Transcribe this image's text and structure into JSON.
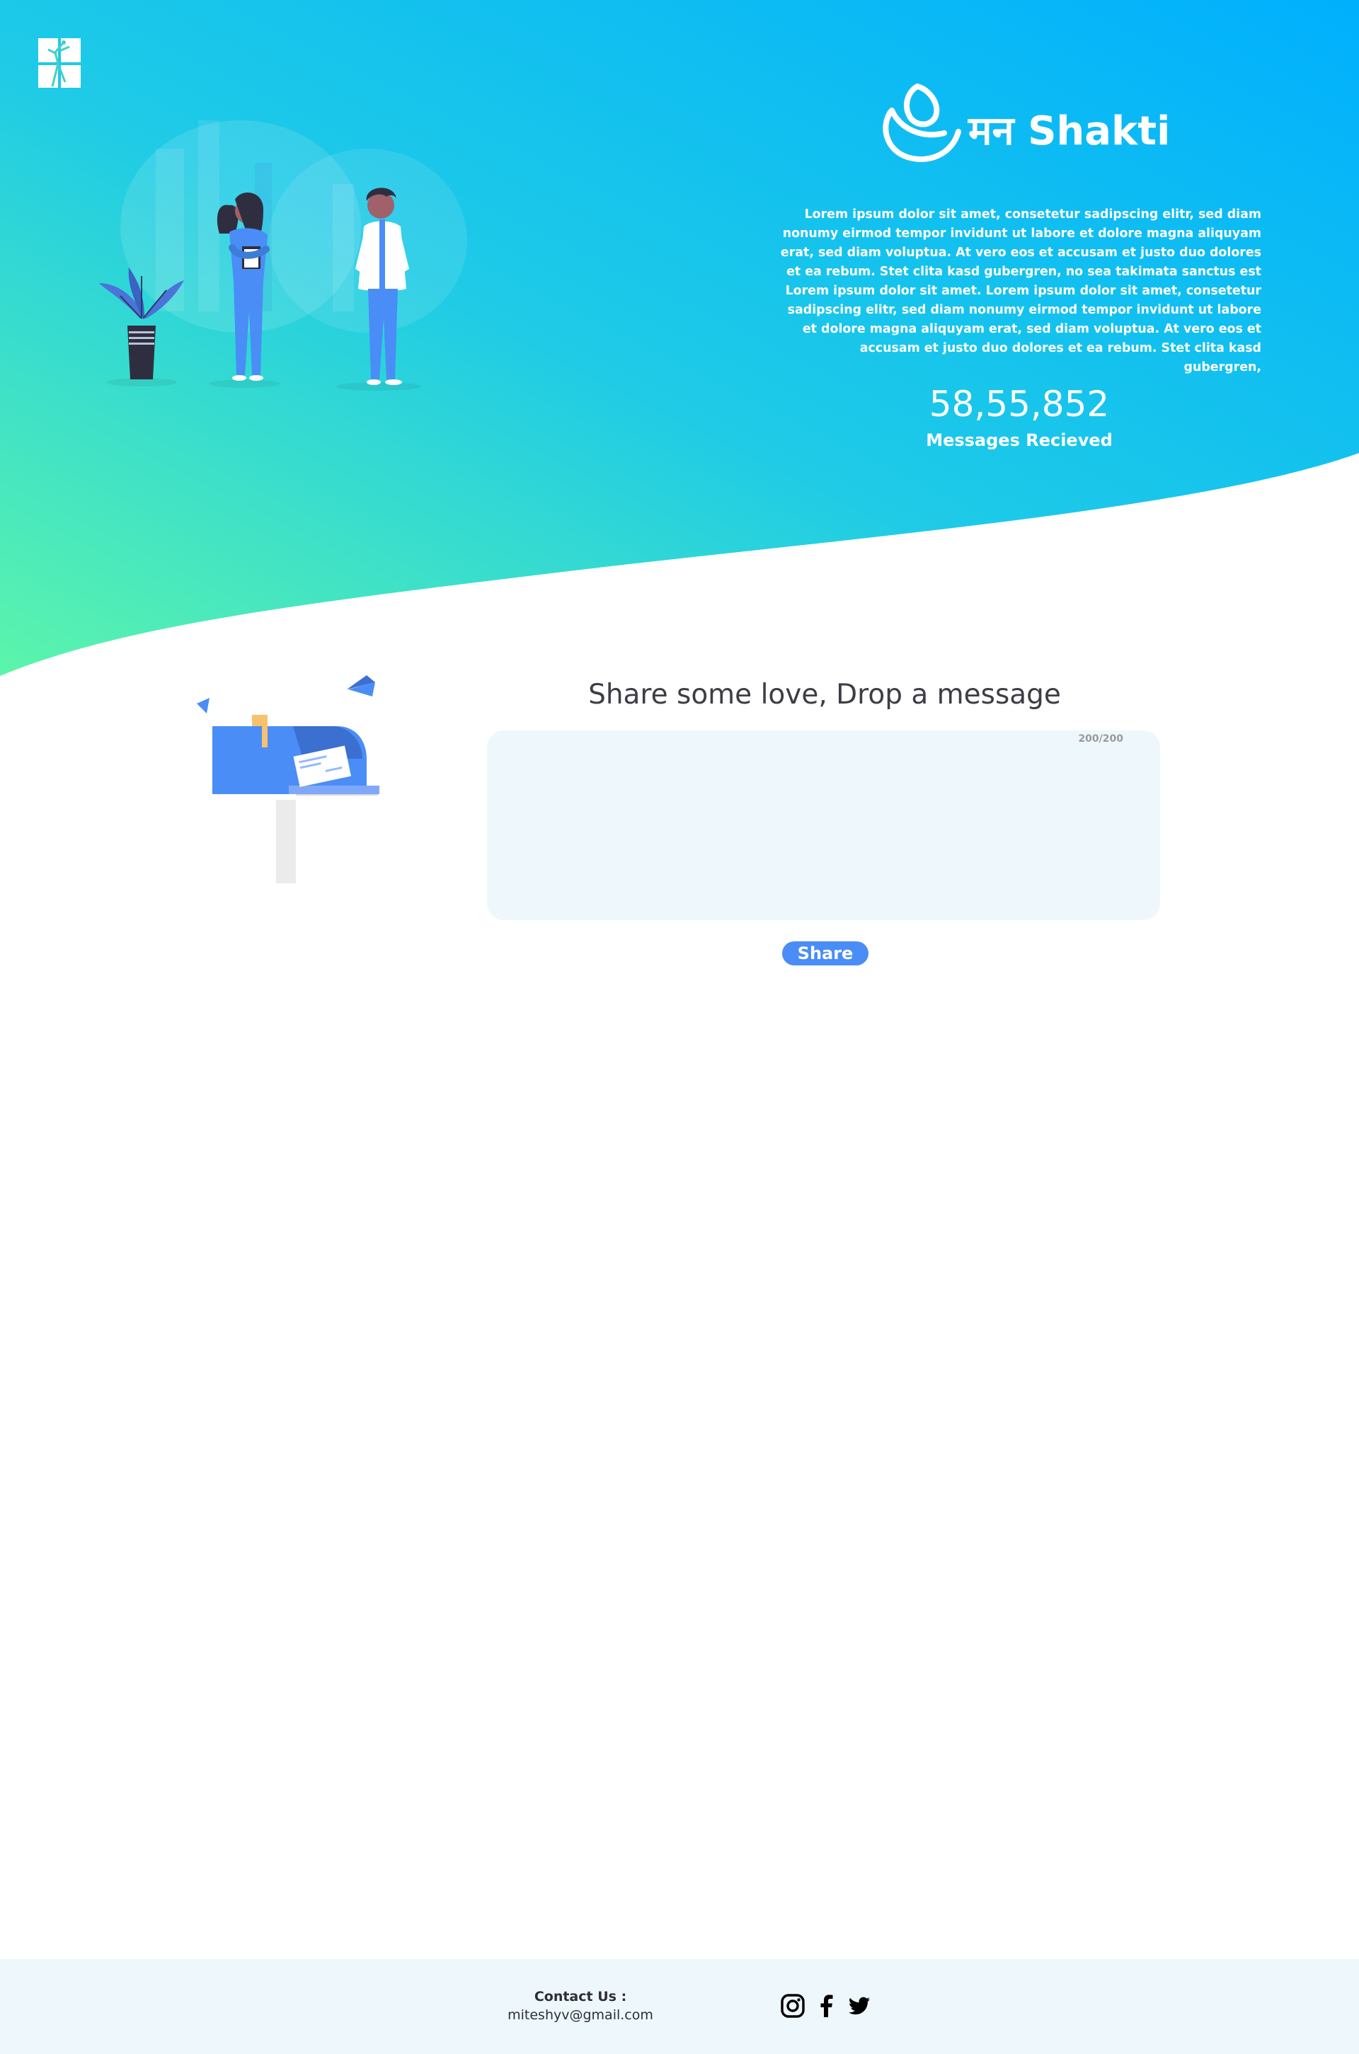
{
  "brand": {
    "name": "मन Shakti",
    "logo_icon": "drop-leaf-icon",
    "corner_logo_icon": "figure-logo-icon"
  },
  "hero": {
    "description": "Lorem ipsum dolor sit amet, consetetur sadipscing elitr, sed diam nonumy eirmod tempor invidunt ut labore et dolore magna aliquyam erat, sed diam voluptua. At vero eos et accusam et justo duo dolores et ea rebum. Stet clita kasd gubergren, no sea takimata sanctus est Lorem ipsum dolor sit amet. Lorem ipsum dolor sit amet, consetetur sadipscing elitr, sed diam nonumy eirmod tempor invidunt ut labore et dolore magna aliquyam erat, sed diam voluptua. At vero eos et accusam et justo duo dolores et ea rebum. Stet clita kasd gubergren,",
    "stat_value": "58,55,852",
    "stat_label": "Messages Recieved",
    "illustration": "doctors-illustration"
  },
  "message_section": {
    "heading": "Share some love, Drop a message",
    "char_count": "200/200",
    "input_value": "",
    "share_label": "Share",
    "illustration": "mailbox-illustration"
  },
  "footer": {
    "contact_title": "Contact Us :",
    "contact_email": "miteshyv@gmail.com",
    "social_icons": [
      "instagram-icon",
      "facebook-icon",
      "twitter-icon"
    ]
  },
  "colors": {
    "gradient_start": "#5cf5ab",
    "gradient_mid": "#1fcbe6",
    "gradient_end": "#00b0fd",
    "accent": "#4a8df6",
    "text_dark": "#3d3d46",
    "panel_bg": "#eef8fc"
  }
}
